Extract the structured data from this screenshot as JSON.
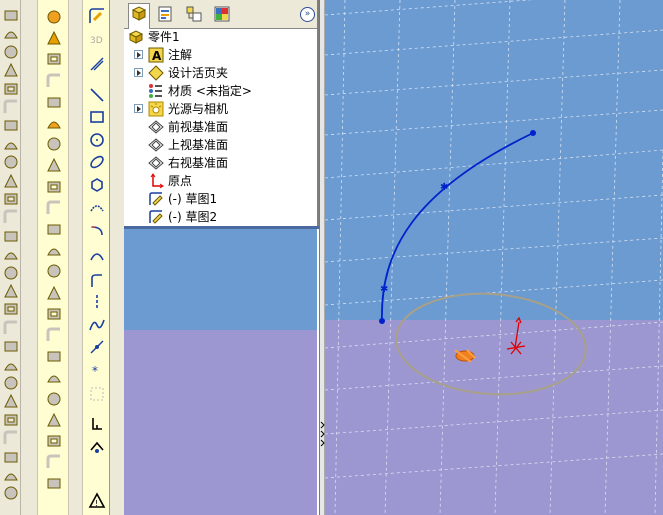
{
  "feature_manager": {
    "tabs": [
      "feature-manager-tab",
      "property-manager-tab",
      "configuration-manager-tab",
      "display-manager-tab"
    ],
    "expand_glyph": "»",
    "tree": {
      "root": {
        "label": "零件1",
        "icon": "part-icon"
      },
      "items": [
        {
          "label": "注解",
          "icon": "annotations-icon",
          "expandable": true
        },
        {
          "label": "设计活页夹",
          "icon": "design-binder-icon",
          "expandable": true
        },
        {
          "label": "材质 <未指定>",
          "icon": "material-icon",
          "expandable": false
        },
        {
          "label": "光源与相机",
          "icon": "lights-camera-icon",
          "expandable": true
        },
        {
          "label": "前视基准面",
          "icon": "plane-icon",
          "expandable": false
        },
        {
          "label": "上视基准面",
          "icon": "plane-icon",
          "expandable": false
        },
        {
          "label": "右视基准面",
          "icon": "plane-icon",
          "expandable": false
        },
        {
          "label": "原点",
          "icon": "origin-icon",
          "expandable": false
        },
        {
          "label": "(-) 草图1",
          "icon": "sketch-icon",
          "expandable": false
        },
        {
          "label": "(-) 草图2",
          "icon": "sketch-icon",
          "expandable": false
        }
      ]
    }
  },
  "toolbars": {
    "features": [
      "extrude-icon",
      "revolve-icon",
      "sweep-icon",
      "loft-icon",
      "cut-icon",
      "fillet-icon",
      "chamfer-icon",
      "rib-icon",
      "shell-icon",
      "draft-icon",
      "hole-icon",
      "dome-icon",
      "mirror-icon",
      "pattern-icon",
      "scale-icon",
      "split-icon",
      "wrap-icon",
      "combine-icon",
      "move-icon",
      "delete-icon",
      "reference-icon",
      "curves-icon",
      "instant3d-icon"
    ],
    "sketch": [
      "sketch-icon",
      "3d-sketch-icon",
      "smart-dimension-icon",
      "line-icon",
      "rectangle-icon",
      "circle-icon",
      "ellipse-icon",
      "polygon-icon",
      "arc-icon",
      "tangent-arc-icon",
      "three-point-arc-icon",
      "centerline-icon",
      "spline-icon",
      "point-icon",
      "construction-icon",
      "grid-icon",
      "add-relation-icon",
      "display-relation-icon",
      "offset-icon",
      "repair-icon"
    ]
  },
  "colors": {
    "viewport_top": "#6b9bd1",
    "viewport_bottom": "#9c97d0",
    "sketch_curve": "#0022cc",
    "origin_red": "#e00000",
    "toolbar_bg": "#fffed2"
  }
}
